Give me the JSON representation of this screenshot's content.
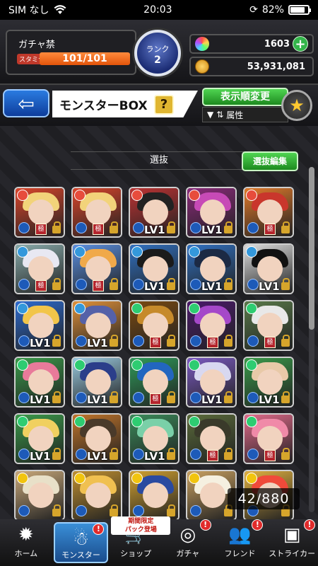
{
  "status_bar": {
    "carrier": "SIM なし",
    "time": "20:03",
    "battery": "82%",
    "battery_level": 0.82
  },
  "player": {
    "name": "ガチャ禁",
    "stamina_label": "スタミナ",
    "stamina": "101/101",
    "stamina_fraction": 1.0
  },
  "rank": {
    "label": "ランク",
    "value": "2"
  },
  "currency": {
    "orbs": "1603",
    "gold": "53,931,081"
  },
  "title_bar": {
    "back_icon": "back-arrow-icon",
    "title": "モンスターBOX",
    "help": "?",
    "sort_label": "表示順変更",
    "sort_filter": "属性",
    "favorite_icon": "star-icon"
  },
  "box": {
    "section_label": "選抜",
    "edit_label": "選抜編集",
    "count": "42/880",
    "level_label": "LV1"
  },
  "monsters": [
    {
      "hair": "#f2d37a",
      "bg": "#d9452b",
      "elem": "#e74c3c",
      "lv": false,
      "kyoku": true
    },
    {
      "hair": "#f2d37a",
      "bg": "#d9452b",
      "elem": "#e74c3c",
      "lv": false,
      "kyoku": true
    },
    {
      "hair": "#222222",
      "bg": "#b33",
      "elem": "#e74c3c",
      "lv": true,
      "kyoku": false
    },
    {
      "hair": "#c74ab6",
      "bg": "#8a2a7a",
      "elem": "#e74c3c",
      "lv": true,
      "kyoku": false
    },
    {
      "hair": "#c9362c",
      "bg": "#e07a2b",
      "elem": "#e74c3c",
      "lv": false,
      "kyoku": true
    },
    {
      "hair": "#e8e8f2",
      "bg": "#8aa",
      "elem": "#3498db",
      "lv": false,
      "kyoku": true
    },
    {
      "hair": "#f0a94a",
      "bg": "#5a8fe0",
      "elem": "#3498db",
      "lv": false,
      "kyoku": true
    },
    {
      "hair": "#1b1b1b",
      "bg": "#3070c0",
      "elem": "#3498db",
      "lv": true,
      "kyoku": false
    },
    {
      "hair": "#1c2a44",
      "bg": "#3070c0",
      "elem": "#3498db",
      "lv": true,
      "kyoku": false
    },
    {
      "hair": "#111111",
      "bg": "#ddd",
      "elem": "#3498db",
      "lv": true,
      "kyoku": false
    },
    {
      "hair": "#f2c54a",
      "bg": "#2d6bd0",
      "elem": "#3498db",
      "lv": true,
      "kyoku": false
    },
    {
      "hair": "#5561a8",
      "bg": "#e0913a",
      "elem": "#3498db",
      "lv": true,
      "kyoku": false
    },
    {
      "hair": "#c68a2b",
      "bg": "#7a4a12",
      "elem": "#2ecc71",
      "lv": false,
      "kyoku": true
    },
    {
      "hair": "#a548c9",
      "bg": "#4a1a6a",
      "elem": "#2ecc71",
      "lv": false,
      "kyoku": true
    },
    {
      "hair": "#e8e8e8",
      "bg": "#5a7a4a",
      "elem": "#2ecc71",
      "lv": false,
      "kyoku": true
    },
    {
      "hair": "#e87a9a",
      "bg": "#3a9a4a",
      "elem": "#2ecc71",
      "lv": true,
      "kyoku": false
    },
    {
      "hair": "#2b3e8a",
      "bg": "#9acae0",
      "elem": "#2ecc71",
      "lv": true,
      "kyoku": false
    },
    {
      "hair": "#2266c0",
      "bg": "#2f9a5a",
      "elem": "#2ecc71",
      "lv": false,
      "kyoku": true
    },
    {
      "hair": "#d8d8f0",
      "bg": "#7a5ac0",
      "elem": "#2ecc71",
      "lv": true,
      "kyoku": false
    },
    {
      "hair": "#e8c9a8",
      "bg": "#3a9a4a",
      "elem": "#2ecc71",
      "lv": true,
      "kyoku": false
    },
    {
      "hair": "#f0d060",
      "bg": "#3a9a4a",
      "elem": "#2ecc71",
      "lv": true,
      "kyoku": false
    },
    {
      "hair": "#4a3a2a",
      "bg": "#c0742a",
      "elem": "#2ecc71",
      "lv": true,
      "kyoku": false
    },
    {
      "hair": "#7ad0a8",
      "bg": "#3a8a5a",
      "elem": "#2ecc71",
      "lv": true,
      "kyoku": false
    },
    {
      "hair": "#3a3a2a",
      "bg": "#5a6a3a",
      "elem": "#2ecc71",
      "lv": false,
      "kyoku": true
    },
    {
      "hair": "#f08aa8",
      "bg": "#e06a8a",
      "elem": "#2ecc71",
      "lv": false,
      "kyoku": true
    },
    {
      "hair": "#e8e0c8",
      "bg": "#c8a87a",
      "elem": "#f1c40f",
      "lv": false,
      "kyoku": false
    },
    {
      "hair": "#f0c050",
      "bg": "#c09030",
      "elem": "#f1c40f",
      "lv": false,
      "kyoku": false
    },
    {
      "hair": "#2a4aa0",
      "bg": "#d0a030",
      "elem": "#f1c40f",
      "lv": false,
      "kyoku": false
    },
    {
      "hair": "#f5f0e0",
      "bg": "#c8a060",
      "elem": "#f1c40f",
      "lv": false,
      "kyoku": false
    },
    {
      "hair": "#f04a3a",
      "bg": "#e0b040",
      "elem": "#f1c40f",
      "lv": false,
      "kyoku": false
    }
  ],
  "nav": [
    {
      "label": "ホーム",
      "icon": "home-icon",
      "glyph": "✹",
      "badge": ""
    },
    {
      "label": "モンスター",
      "icon": "monster-icon",
      "glyph": "☃",
      "badge": "!"
    },
    {
      "label": "ショップ",
      "icon": "cart-icon",
      "glyph": "🛒",
      "badge": "!",
      "promo": "期間限定\nパック登場"
    },
    {
      "label": "ガチャ",
      "icon": "gacha-icon",
      "glyph": "◎",
      "badge": "!"
    },
    {
      "label": "フレンド",
      "icon": "friend-icon",
      "glyph": "👥",
      "badge": "!"
    },
    {
      "label": "ストライカー",
      "icon": "striker-icon",
      "glyph": "▣",
      "badge": "!"
    }
  ]
}
